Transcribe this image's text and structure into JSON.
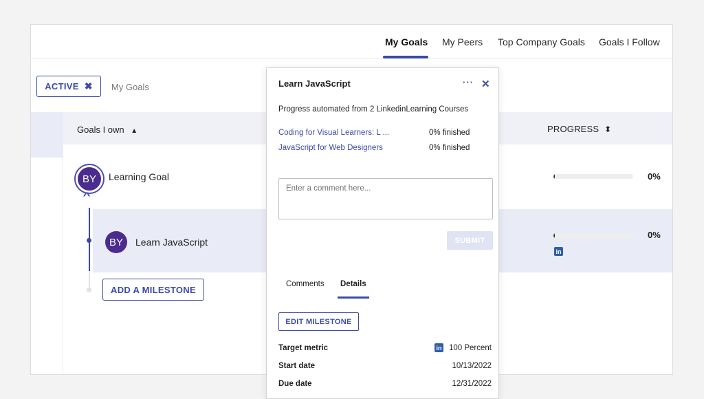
{
  "nav": {
    "tabs": [
      {
        "label": "My Goals",
        "active": true
      },
      {
        "label": "My Peers",
        "active": false
      },
      {
        "label": "Top Company Goals",
        "active": false
      },
      {
        "label": "Goals I Follow",
        "active": false
      }
    ]
  },
  "filter": {
    "chip_label": "ACTIVE",
    "chip_close_icon": "✖",
    "scope_label": "My Goals"
  },
  "table": {
    "col_goals": "Goals I own",
    "col_goals_sort_icon": "▲",
    "col_progress": "PROGRESS",
    "col_progress_sort_icon": "⬍",
    "goals": [
      {
        "initials": "BY",
        "title": "Learning Goal",
        "progress": 0,
        "progress_label": "0%"
      },
      {
        "initials": "BY",
        "title": "Learn JavaScript",
        "progress": 0,
        "progress_label": "0%",
        "source_icon": "in"
      }
    ],
    "add_milestone_label": "ADD A MILESTONE"
  },
  "popup": {
    "title": "Learn JavaScript",
    "more_icon": "···",
    "close_icon": "✕",
    "automated_text": "Progress automated from 2 LinkedinLearning Courses",
    "courses": [
      {
        "name": "Coding for Visual Learners: L ...",
        "status": "0% finished"
      },
      {
        "name": "JavaScript for Web Designers",
        "status": "0% finished"
      }
    ],
    "comment_placeholder": "Enter a comment here...",
    "submit_label": "SUBMIT",
    "tabs": [
      {
        "label": "Comments",
        "active": false
      },
      {
        "label": "Details",
        "active": true
      }
    ],
    "edit_label": "EDIT MILESTONE",
    "details": [
      {
        "label": "Target metric",
        "value": "100 Percent",
        "icon": "in"
      },
      {
        "label": "Start date",
        "value": "10/13/2022"
      },
      {
        "label": "Due date",
        "value": "12/31/2022"
      }
    ]
  },
  "colors": {
    "accent": "#3b4aa8",
    "avatar": "#4b2b8e",
    "linkedin": "#2f5ea8"
  }
}
